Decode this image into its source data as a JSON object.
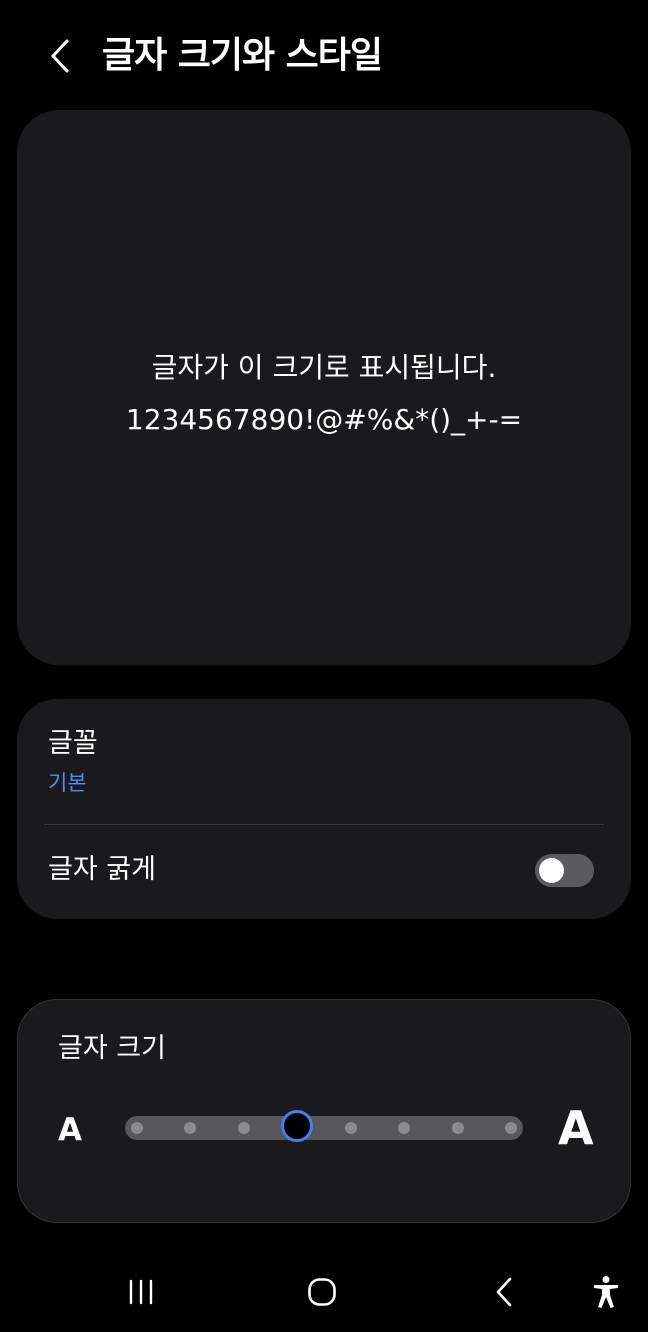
{
  "header": {
    "title": "글자 크기와 스타일",
    "back_icon": "chevron-left-icon"
  },
  "preview": {
    "line1": "글자가 이 크기로 표시됩니다.",
    "line2": "1234567890!@#%&*()_+-="
  },
  "settings": {
    "font_label": "글꼴",
    "font_value": "기본",
    "bold_label": "글자 굵게",
    "bold_enabled": false
  },
  "font_size": {
    "title": "글자 크기",
    "small_label": "A",
    "large_label": "A",
    "steps": 8,
    "selected_step": 4
  },
  "nav": {
    "recents_icon": "recents-icon",
    "home_icon": "home-icon",
    "back_icon": "back-icon",
    "accessibility_icon": "accessibility-icon"
  },
  "colors": {
    "background": "#000000",
    "card": "#1a1a1d",
    "accent": "#3d82f5",
    "link": "#4f8ff7"
  }
}
